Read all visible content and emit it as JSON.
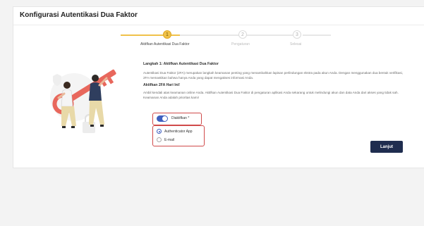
{
  "page": {
    "title": "Konfigurasi Autentikasi Dua Faktor"
  },
  "stepper": {
    "steps": [
      {
        "number": "1",
        "label": "Aktifkan Autentikasi Dua Faktor",
        "state": "active"
      },
      {
        "number": "2",
        "label": "Pengaturan",
        "state": "inactive"
      },
      {
        "number": "3",
        "label": "Selesai",
        "state": "inactive"
      }
    ]
  },
  "content": {
    "step_heading": "Langkah 1: Aktifkan Autentikasi Dua Faktor",
    "intro_text": "Autentikasi Dua Faktor (2FA) merupakan langkah keamanan penting yang menambahkan lapisan perlindungan ekstra pada akun Anda. Dengan menggunakan dua bentuk verifikasi, 2FA memastikan bahwa hanya Anda yang dapat mengakses informasi Anda.",
    "subheading": "Aktifkan 2FA Hari Ini!",
    "cta_text": "Ambil kendali atas keamanan online Anda. Aktifkan Autentikasi Dua Faktor di pengaturan aplikasi Anda sekarang untuk melindungi akun dan data Anda dari akses yang tidak sah. Keamanan Anda adalah prioritas kami!"
  },
  "toggle": {
    "label": "Diaktifkan *",
    "state": "on"
  },
  "method": {
    "options": [
      {
        "label": "Authenticator App",
        "selected": true
      },
      {
        "label": "E-mail",
        "selected": false
      }
    ]
  },
  "actions": {
    "next_label": "Lanjut"
  },
  "colors": {
    "accent_yellow": "#f0c24a",
    "primary_blue": "#3f5fbf",
    "button_navy": "#1f2d4f",
    "highlight_red": "#d04a4a",
    "key_red": "#e8675c"
  }
}
